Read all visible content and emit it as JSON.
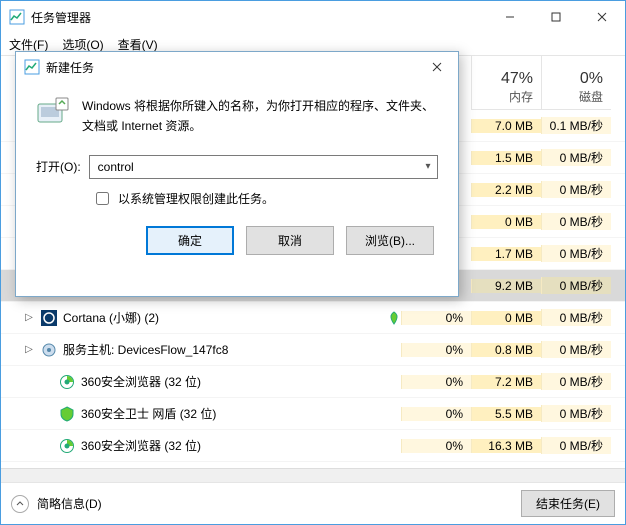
{
  "window": {
    "title": "任务管理器",
    "menu": {
      "file": "文件(F)",
      "options": "选项(O)",
      "view": "查看(V)"
    },
    "min_tip": "—",
    "max_tip": "▢",
    "close_tip": "✕"
  },
  "columns": {
    "cpu": {
      "pct": "",
      "label": ""
    },
    "mem": {
      "pct": "47%",
      "label": "内存"
    },
    "disk": {
      "pct": "0%",
      "label": "磁盘"
    }
  },
  "rows": [
    {
      "expand": false,
      "icon": "",
      "name": "",
      "leaf": "",
      "cpu": "",
      "mem": "7.0 MB",
      "disk": "0.1 MB/秒",
      "selected": false
    },
    {
      "expand": false,
      "icon": "",
      "name": "",
      "leaf": "",
      "cpu": "",
      "mem": "1.5 MB",
      "disk": "0 MB/秒",
      "selected": false
    },
    {
      "expand": false,
      "icon": "",
      "name": "",
      "leaf": "",
      "cpu": "",
      "mem": "2.2 MB",
      "disk": "0 MB/秒",
      "selected": false
    },
    {
      "expand": false,
      "icon": "",
      "name": "",
      "leaf": "",
      "cpu": "",
      "mem": "0 MB",
      "disk": "0 MB/秒",
      "selected": false
    },
    {
      "expand": false,
      "icon": "",
      "name": "",
      "leaf": "",
      "cpu": "",
      "mem": "1.7 MB",
      "disk": "0 MB/秒",
      "selected": false
    },
    {
      "expand": false,
      "icon": "",
      "name": "",
      "leaf": "",
      "cpu": "",
      "mem": "9.2 MB",
      "disk": "0 MB/秒",
      "selected": true
    },
    {
      "expand": true,
      "icon": "cortana",
      "name": "Cortana (小娜) (2)",
      "leaf": "green",
      "cpu": "0%",
      "mem": "0 MB",
      "disk": "0 MB/秒",
      "selected": false
    },
    {
      "expand": true,
      "icon": "svc",
      "name": "服务主机: DevicesFlow_147fc8",
      "leaf": "",
      "cpu": "0%",
      "mem": "0.8 MB",
      "disk": "0 MB/秒",
      "selected": false
    },
    {
      "expand": false,
      "icon": "360e",
      "name": "360安全浏览器 (32 位)",
      "leaf": "",
      "cpu": "0%",
      "mem": "7.2 MB",
      "disk": "0 MB/秒",
      "selected": false,
      "indent": true
    },
    {
      "expand": false,
      "icon": "360s",
      "name": "360安全卫士 网盾 (32 位)",
      "leaf": "",
      "cpu": "0%",
      "mem": "5.5 MB",
      "disk": "0 MB/秒",
      "selected": false,
      "indent": true
    },
    {
      "expand": false,
      "icon": "360e",
      "name": "360安全浏览器 (32 位)",
      "leaf": "",
      "cpu": "0%",
      "mem": "16.3 MB",
      "disk": "0 MB/秒",
      "selected": false,
      "indent": true
    }
  ],
  "statusbar": {
    "brief": "简略信息(D)",
    "end_task": "结束任务(E)"
  },
  "dialog": {
    "title": "新建任务",
    "message": "Windows 将根据你所键入的名称，为你打开相应的程序、文件夹、文档或 Internet 资源。",
    "open_label": "打开(O):",
    "open_value": "control",
    "admin_check": "以系统管理权限创建此任务。",
    "ok": "确定",
    "cancel": "取消",
    "browse": "浏览(B)..."
  }
}
